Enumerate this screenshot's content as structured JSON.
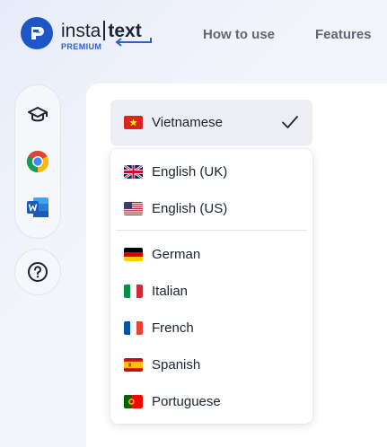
{
  "header": {
    "logo_word_1": "insta",
    "logo_word_2": "text",
    "logo_badge": "PREMIUM",
    "nav": [
      {
        "label": "How to use"
      },
      {
        "label": "Features"
      }
    ]
  },
  "sidebar": {
    "items": [
      {
        "icon": "graduation-cap-icon"
      },
      {
        "icon": "chrome-icon"
      },
      {
        "icon": "word-icon"
      }
    ],
    "help_icon": "question-circle-icon"
  },
  "language_select": {
    "selected": {
      "label": "Vietnamese",
      "flag": "vietnam-flag-icon"
    },
    "options_top": [
      {
        "label": "English (UK)",
        "flag": "uk-flag-icon"
      },
      {
        "label": "English (US)",
        "flag": "us-flag-icon"
      }
    ],
    "options": [
      {
        "label": "German",
        "flag": "germany-flag-icon"
      },
      {
        "label": "Italian",
        "flag": "italy-flag-icon"
      },
      {
        "label": "French",
        "flag": "france-flag-icon"
      },
      {
        "label": "Spanish",
        "flag": "spain-flag-icon"
      },
      {
        "label": "Portuguese",
        "flag": "portugal-flag-icon"
      }
    ]
  },
  "colors": {
    "brand": "#1f56c7",
    "text": "#1c2431",
    "nav_text": "#5f6775",
    "selected_bg": "#eceef3"
  }
}
